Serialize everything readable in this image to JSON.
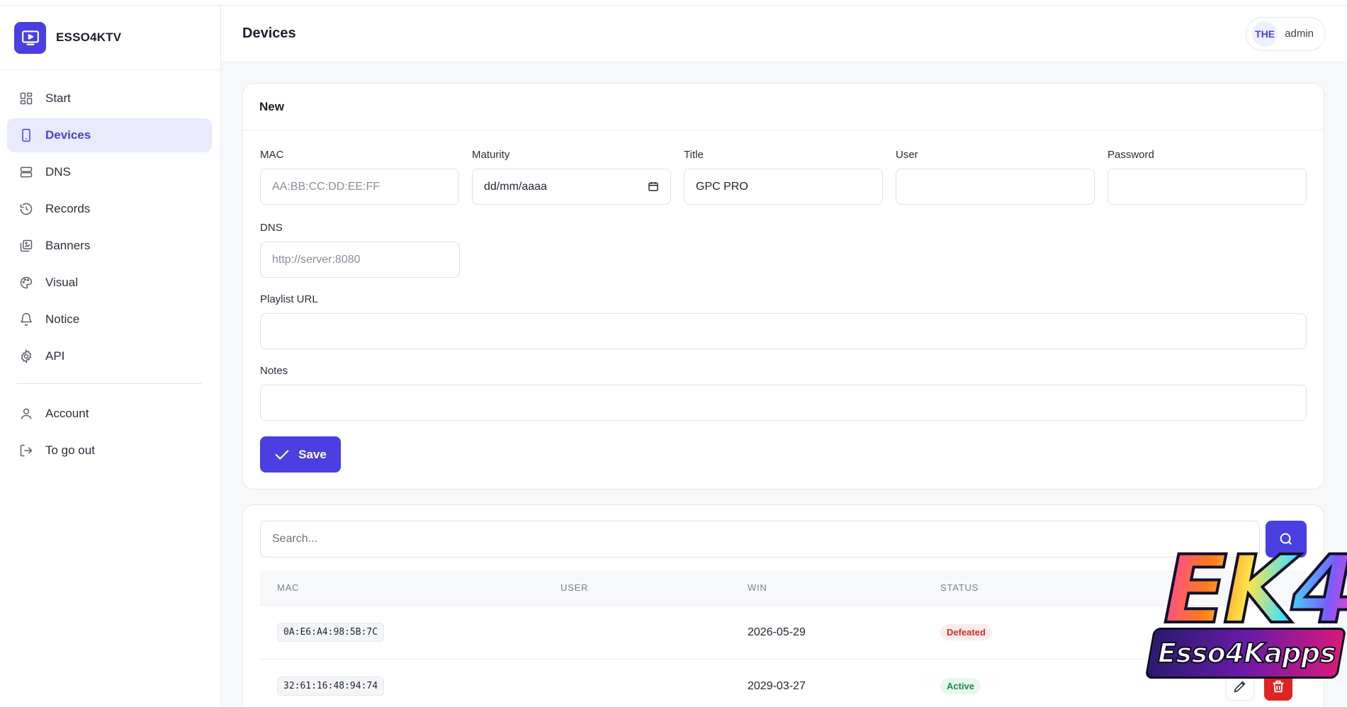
{
  "app": {
    "name": "ESSO4KTV"
  },
  "sidebar": {
    "items": [
      {
        "label": "Start",
        "icon": "grid-icon",
        "active": false
      },
      {
        "label": "Devices",
        "icon": "tablet-icon",
        "active": true
      },
      {
        "label": "DNS",
        "icon": "server-icon",
        "active": false
      },
      {
        "label": "Records",
        "icon": "history-icon",
        "active": false
      },
      {
        "label": "Banners",
        "icon": "images-icon",
        "active": false
      },
      {
        "label": "Visual",
        "icon": "palette-icon",
        "active": false
      },
      {
        "label": "Notice",
        "icon": "bell-icon",
        "active": false
      },
      {
        "label": "API",
        "icon": "gear-icon",
        "active": false
      }
    ],
    "footer_items": [
      {
        "label": "Account",
        "icon": "user-icon"
      },
      {
        "label": "To go out",
        "icon": "logout-icon"
      }
    ]
  },
  "header": {
    "title": "Devices",
    "user_initials": "THE",
    "user_name": "admin"
  },
  "form": {
    "title": "New",
    "mac": {
      "label": "MAC",
      "value": "",
      "placeholder": "AA:BB:CC:DD:EE:FF"
    },
    "maturity": {
      "label": "Maturity",
      "value": "dd/mm/aaaa"
    },
    "title_field": {
      "label": "Title",
      "value": "GPC PRO"
    },
    "user": {
      "label": "User",
      "value": ""
    },
    "password": {
      "label": "Password",
      "value": ""
    },
    "dns": {
      "label": "DNS",
      "value": "",
      "placeholder": "http://server:8080"
    },
    "playlist": {
      "label": "Playlist URL",
      "value": ""
    },
    "notes": {
      "label": "Notes",
      "value": ""
    },
    "save_label": "Save"
  },
  "list": {
    "search_placeholder": "Search...",
    "columns": {
      "mac": "MAC",
      "user": "USER",
      "win": "WIN",
      "status": "STATUS"
    },
    "rows": [
      {
        "mac": "0A:E6:A4:98:5B:7C",
        "user": "",
        "win": "2026-05-29",
        "status": "Defeated"
      },
      {
        "mac": "32:61:16:48:94:74",
        "user": "",
        "win": "2029-03-27",
        "status": "Active"
      }
    ]
  },
  "watermark": {
    "top": "EK4",
    "bottom": "Esso4Kapps"
  },
  "colors": {
    "accent": "#4a3fe0",
    "active_bg": "#e9ebfd",
    "danger": "#e02424",
    "success": "#1f8a4c"
  }
}
